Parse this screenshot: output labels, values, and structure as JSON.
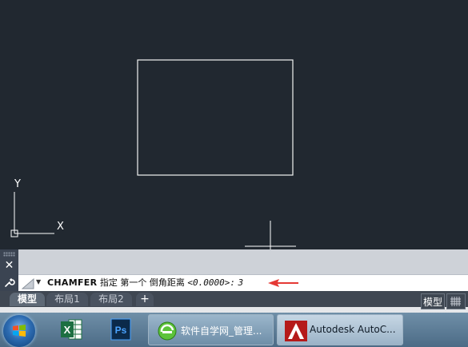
{
  "canvas": {
    "ucs_y_label": "Y",
    "ucs_x_label": "X"
  },
  "command_line": {
    "command": "CHAMFER",
    "prompt_text": "指定 第一个 倒角距离",
    "default_value": "<0.0000>:",
    "entered_value": "3"
  },
  "layout_tabs": {
    "items": [
      {
        "label": "模型",
        "active": true
      },
      {
        "label": "布局1",
        "active": false
      },
      {
        "label": "布局2",
        "active": false
      }
    ],
    "add_label": "+"
  },
  "status_bar": {
    "model_label": "模型"
  },
  "taskbar": {
    "windows": [
      {
        "label": "软件自学网_管理...",
        "icon": "browser-icon",
        "active": false
      },
      {
        "label": "Autodesk AutoC...",
        "icon": "autocad-icon",
        "active": true
      }
    ],
    "pinned": [
      {
        "icon": "excel-icon",
        "label": "X"
      },
      {
        "icon": "photoshop-icon",
        "label": "Ps"
      }
    ]
  },
  "colors": {
    "canvas_bg": "#212830",
    "arrow_red": "#e53935"
  }
}
